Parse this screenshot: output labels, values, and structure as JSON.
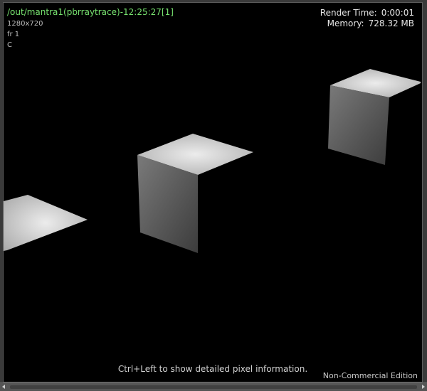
{
  "viewer": {
    "title": "/out/mantra1(pbrraytrace)-12:25:27[1]",
    "resolution": "1280x720",
    "frame": "fr 1",
    "channel": "C"
  },
  "stats": {
    "render_time_label": "Render Time:",
    "render_time_value": "0:00:01",
    "memory_label": "Memory:",
    "memory_value": "728.32 MB"
  },
  "hint": "Ctrl+Left to show detailed pixel information.",
  "edition": "Non-Commercial Edition",
  "colors": {
    "title": "#77e26f",
    "background": "#000000"
  }
}
